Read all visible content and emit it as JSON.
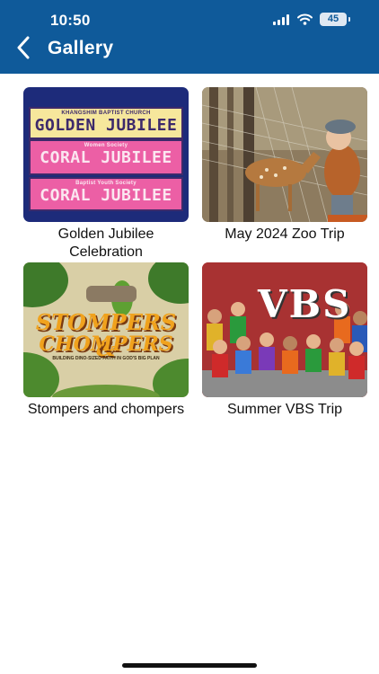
{
  "status_bar": {
    "time": "10:50",
    "battery": "45"
  },
  "header": {
    "title": "Gallery",
    "back_icon": "chevron-left-icon"
  },
  "gallery": {
    "items": [
      {
        "caption": "Golden Jubilee Celebration",
        "image_text": {
          "line1_small": "KHANGSHIM BAPTIST CHURCH",
          "line1_big": "GOLDEN JUBILEE",
          "line2_small": "Women Society",
          "line2_big": "CORAL JUBILEE",
          "line3_small": "Baptist Youth Society",
          "line3_big": "CORAL JUBILEE"
        }
      },
      {
        "caption": "May 2024 Zoo Trip"
      },
      {
        "caption": "Stompers and chompers",
        "image_text": {
          "word1": "STOMPERS &",
          "word2": "CHOMPERS",
          "tagline": "BUILDING DINO-SIZED FAITH IN GOD'S BIG PLAN"
        }
      },
      {
        "caption": "Summer VBS Trip",
        "image_text": {
          "logo": "VBS"
        }
      }
    ]
  },
  "colors": {
    "header_bg": "#0f5a9a",
    "page_bg": "#ffffff"
  }
}
